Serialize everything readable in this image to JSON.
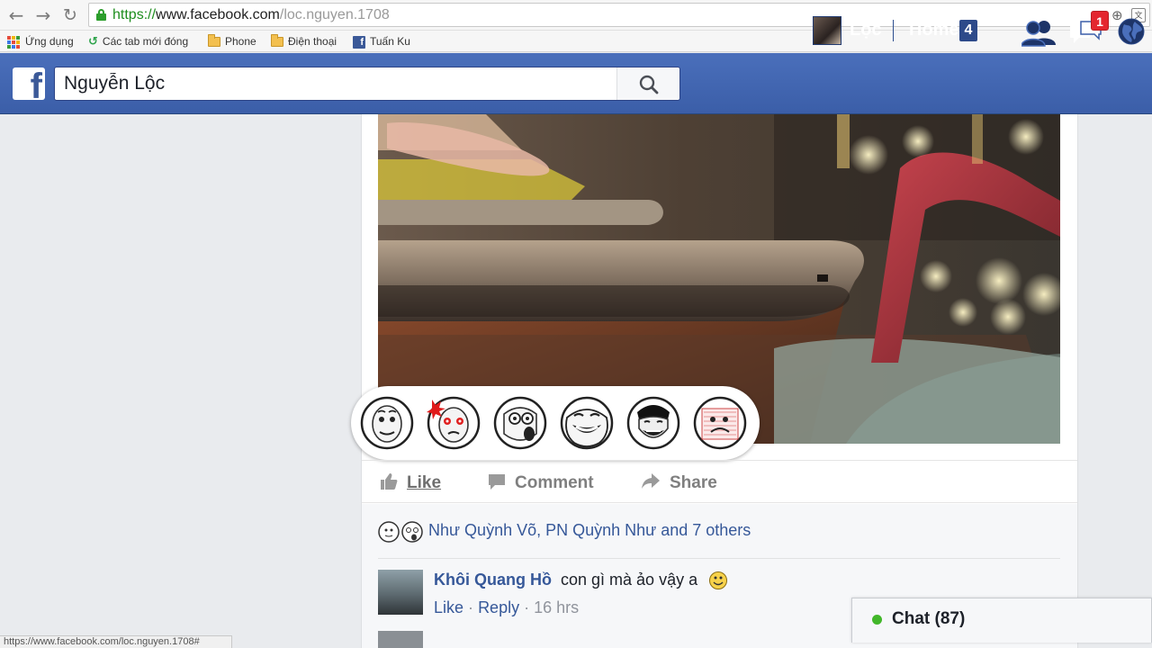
{
  "browser": {
    "url_scheme": "https://",
    "url_host": "www.facebook.com",
    "url_path": "/loc.nguyen.1708",
    "bookmarks": [
      {
        "label": "Ứng dụng",
        "icon": "apps-grid-icon"
      },
      {
        "label": "Các tab mới đóng",
        "icon": "history-icon"
      },
      {
        "label": "Phone",
        "icon": "folder-icon"
      },
      {
        "label": "Điện thoại",
        "icon": "folder-icon"
      },
      {
        "label": "Tuấn Ku",
        "icon": "facebook-icon"
      }
    ],
    "status_url": "https://www.facebook.com/loc.nguyen.1708#"
  },
  "header": {
    "logo": "f",
    "search_value": "Nguyễn Lộc",
    "profile_name": "Lộc",
    "home_label": "Home",
    "home_count": "4",
    "notification_count": "1",
    "colors": {
      "bar": "#4267b2",
      "badge": "#e4262f"
    }
  },
  "post": {
    "actions": {
      "like": "Like",
      "comment": "Comment",
      "share": "Share"
    },
    "likers_text": "Như Quỳnh Võ, PN Quỳnh Như and 7 others",
    "reactions": [
      "rage-face-1-icon",
      "rage-face-2-icon",
      "rage-face-3-icon",
      "trollface-icon",
      "yao-ming-icon",
      "rage-face-6-icon"
    ]
  },
  "comments": [
    {
      "author": "Khôi Quang Hồ",
      "text": "con gì mà ảo vậy a",
      "like_label": "Like",
      "reply_label": "Reply",
      "time": "16 hrs",
      "sep": "·"
    }
  ],
  "chat": {
    "label": "Chat (87)",
    "status_color": "#42b72a"
  }
}
